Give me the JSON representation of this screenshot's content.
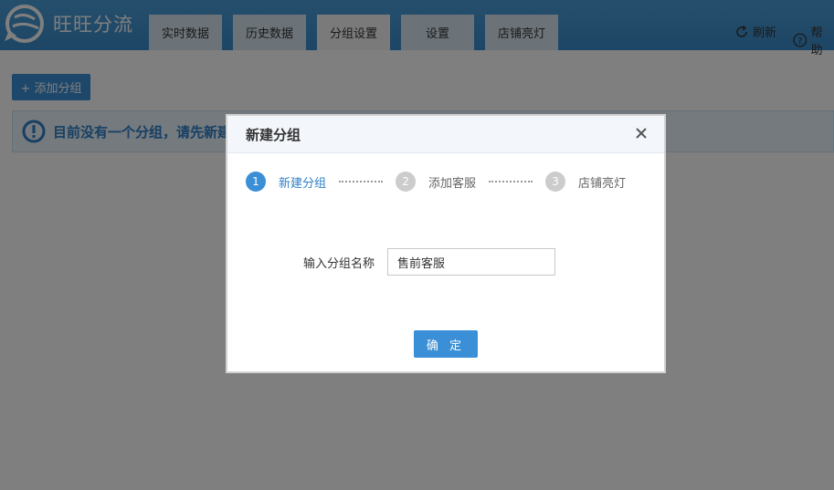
{
  "app": {
    "title": "旺旺分流",
    "logo_icon": "chat-bubble-logo-icon"
  },
  "nav": {
    "tabs": [
      {
        "label": "实时数据"
      },
      {
        "label": "历史数据"
      },
      {
        "label": "分组设置",
        "active": true
      },
      {
        "label": "设置"
      },
      {
        "label": "店铺亮灯"
      }
    ],
    "refresh_label": "刷新",
    "refresh_icon": "refresh-icon",
    "help_label": "帮助",
    "help_icon": "help-icon"
  },
  "page": {
    "add_button_label": "+ 添加分组",
    "notice_text": "目前没有一个分组，请先新建",
    "notice_icon": "warning-icon"
  },
  "modal": {
    "title": "新建分组",
    "close_icon": "close-icon",
    "steps": [
      {
        "num": "1",
        "label": "新建分组",
        "active": true
      },
      {
        "num": "2",
        "label": "添加客服"
      },
      {
        "num": "3",
        "label": "店铺亮灯"
      }
    ],
    "form": {
      "label": "输入分组名称",
      "value": "售前客服"
    },
    "confirm_label": "确 定"
  },
  "colors": {
    "header": "#3b8ccc",
    "accent": "#3a8fd6",
    "step_inactive": "#cccccc"
  }
}
